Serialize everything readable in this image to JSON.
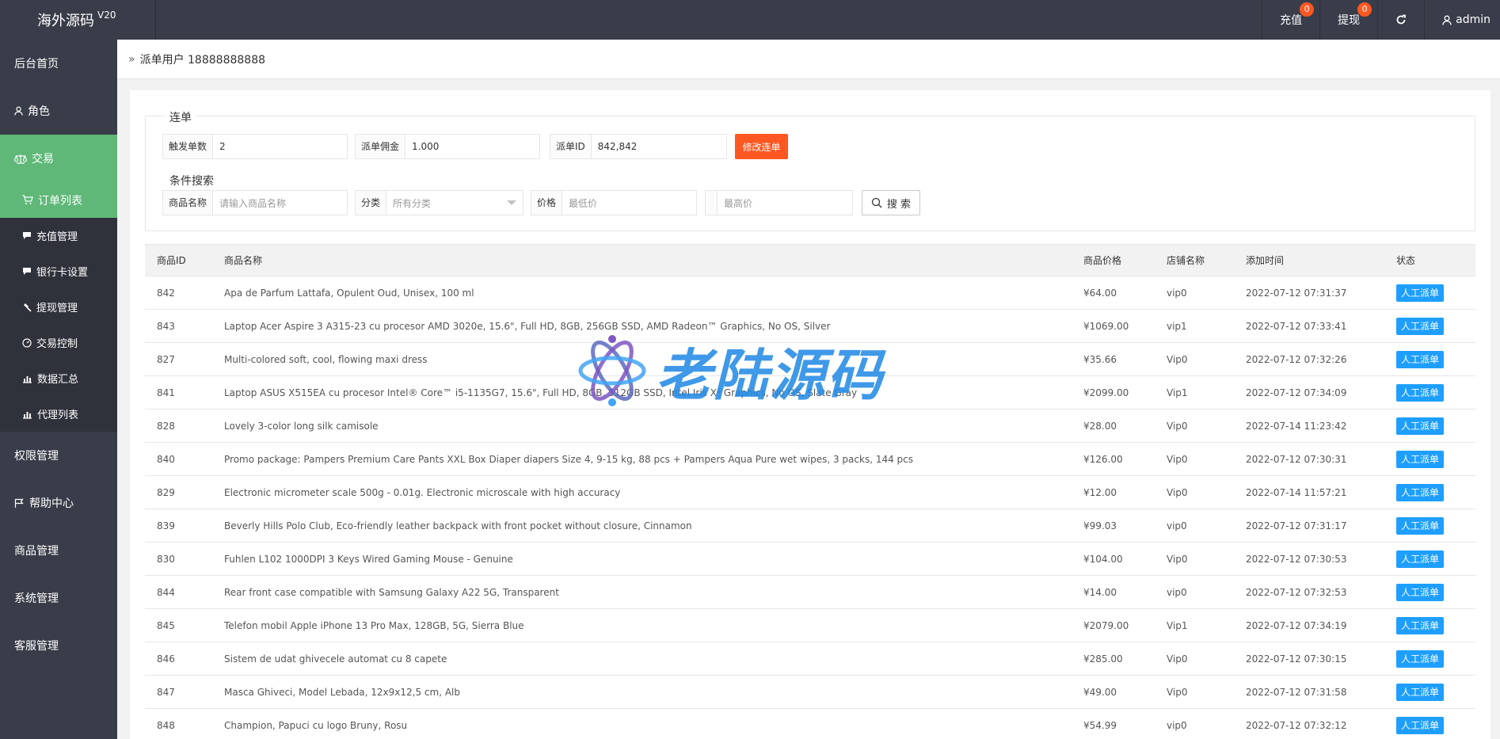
{
  "header": {
    "logo": "海外源码",
    "version": "V20",
    "recharge_label": "充值",
    "recharge_count": "0",
    "withdraw_label": "提现",
    "withdraw_count": "0",
    "user": "admin"
  },
  "sidebar": {
    "items": [
      {
        "label": "后台首页"
      },
      {
        "label": "角色"
      },
      {
        "label": "交易"
      },
      {
        "label": "权限管理"
      },
      {
        "label": "帮助中心"
      },
      {
        "label": "商品管理"
      },
      {
        "label": "系统管理"
      },
      {
        "label": "客服管理"
      }
    ],
    "sub": [
      {
        "label": "订单列表"
      },
      {
        "label": "充值管理"
      },
      {
        "label": "银行卡设置"
      },
      {
        "label": "提现管理"
      },
      {
        "label": "交易控制"
      },
      {
        "label": "数据汇总"
      },
      {
        "label": "代理列表"
      }
    ]
  },
  "breadcrumb": "派单用户 18888888888",
  "form": {
    "section1_title": "连单",
    "trigger_label": "触发单数",
    "trigger_value": "2",
    "commission_label": "派单佣金",
    "commission_value": "1.000",
    "order_id_label": "派单ID",
    "order_id_value": "842,842",
    "modify_button": "修改连单",
    "section2_title": "条件搜索",
    "product_name_label": "商品名称",
    "product_name_placeholder": "请输入商品名称",
    "category_label": "分类",
    "category_value": "所有分类",
    "price_label": "价格",
    "min_price_placeholder": "最低价",
    "max_price_placeholder": "最高价",
    "search_button": "搜 索"
  },
  "table": {
    "headers": [
      "商品ID",
      "商品名称",
      "商品价格",
      "店铺名称",
      "添加时间",
      "状态"
    ],
    "action_label": "人工派单",
    "rows": [
      {
        "id": "842",
        "name": "Apa de Parfum Lattafa, Opulent Oud, Unisex, 100 ml",
        "price": "¥64.00",
        "shop": "vip0",
        "time": "2022-07-12 07:31:37"
      },
      {
        "id": "843",
        "name": "Laptop Acer Aspire 3 A315-23 cu procesor AMD 3020e, 15.6\", Full HD, 8GB, 256GB SSD, AMD Radeon™ Graphics, No OS, Silver",
        "price": "¥1069.00",
        "shop": "vip1",
        "time": "2022-07-12 07:33:41"
      },
      {
        "id": "827",
        "name": "Multi-colored soft, cool, flowing maxi dress",
        "price": "¥35.66",
        "shop": "Vip0",
        "time": "2022-07-12 07:32:26"
      },
      {
        "id": "841",
        "name": "Laptop ASUS X515EA cu procesor Intel® Core™ i5-1135G7, 15.6\", Full HD, 8GB, 512GB SSD, Intel Iris Xᵉ Graphics, No OS, Slate Gray",
        "price": "¥2099.00",
        "shop": "Vip1",
        "time": "2022-07-12 07:34:09"
      },
      {
        "id": "828",
        "name": "Lovely 3-color long silk camisole",
        "price": "¥28.00",
        "shop": "Vip0",
        "time": "2022-07-14 11:23:42"
      },
      {
        "id": "840",
        "name": "Promo package: Pampers Premium Care Pants XXL Box Diaper diapers Size 4, 9-15 kg, 88 pcs + Pampers Aqua Pure wet wipes, 3 packs, 144 pcs",
        "price": "¥126.00",
        "shop": "Vip0",
        "time": "2022-07-12 07:30:31"
      },
      {
        "id": "829",
        "name": "Electronic micrometer scale 500g - 0.01g. Electronic microscale with high accuracy",
        "price": "¥12.00",
        "shop": "Vip0",
        "time": "2022-07-14 11:57:21"
      },
      {
        "id": "839",
        "name": "Beverly Hills Polo Club, Eco-friendly leather backpack with front pocket without closure, Cinnamon",
        "price": "¥99.03",
        "shop": "vip0",
        "time": "2022-07-12 07:31:17"
      },
      {
        "id": "830",
        "name": "Fuhlen L102 1000DPI 3 Keys Wired Gaming Mouse - Genuine",
        "price": "¥104.00",
        "shop": "Vip0",
        "time": "2022-07-12 07:30:53"
      },
      {
        "id": "844",
        "name": "Rear front case compatible with Samsung Galaxy A22 5G, Transparent",
        "price": "¥14.00",
        "shop": "vip0",
        "time": "2022-07-12 07:32:53"
      },
      {
        "id": "845",
        "name": "Telefon mobil Apple iPhone 13 Pro Max, 128GB, 5G, Sierra Blue",
        "price": "¥2079.00",
        "shop": "Vip1",
        "time": "2022-07-12 07:34:19"
      },
      {
        "id": "846",
        "name": "Sistem de udat ghivecele automat cu 8 capete",
        "price": "¥285.00",
        "shop": "Vip0",
        "time": "2022-07-12 07:30:15"
      },
      {
        "id": "847",
        "name": "Masca Ghiveci, Model Lebada, 12x9x12,5 cm, Alb",
        "price": "¥49.00",
        "shop": "Vip0",
        "time": "2022-07-12 07:31:58"
      },
      {
        "id": "848",
        "name": "Champion, Papuci cu logo Bruny, Rosu",
        "price": "¥54.99",
        "shop": "vip0",
        "time": "2022-07-12 07:32:12"
      }
    ]
  },
  "watermark": "老陆源码",
  "colors": {
    "sidebar_bg": "#393d49",
    "active_green": "#5fb878",
    "accent_orange": "#ff5722",
    "accent_blue": "#1e9fff"
  }
}
